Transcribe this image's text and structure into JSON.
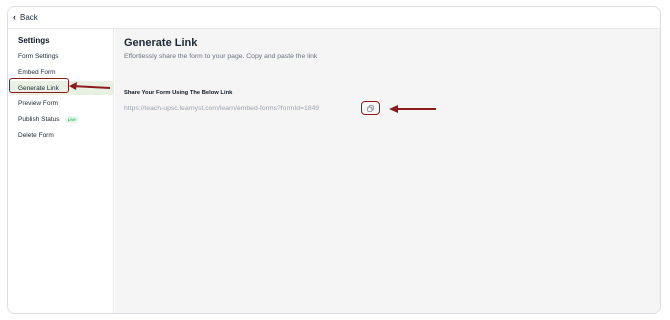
{
  "topbar": {
    "back_label": "Back"
  },
  "sidebar": {
    "title": "Settings",
    "items": [
      {
        "label": "Form Settings"
      },
      {
        "label": "Embed Form"
      },
      {
        "label": "Generate Link"
      },
      {
        "label": "Preview Form"
      },
      {
        "label": "Publish Status",
        "badge": "Live"
      },
      {
        "label": "Delete Form"
      }
    ],
    "active_index": 2
  },
  "main": {
    "title": "Generate Link",
    "subtitle": "Effortlessly share the form to your page. Copy and paste the link",
    "share_label": "Share Your Form Using The Below Link",
    "link": "https://teach-upsc.learnyst.com/learn/embed-forms?formId=1849"
  },
  "icons": {
    "back": "chevron-left-icon",
    "copy": "copy-icon"
  },
  "colors": {
    "active_bg": "#e8f1e4",
    "annotation": "#8c1c1c",
    "main_bg": "#f5f5f5",
    "badge_text": "#16a34a"
  }
}
